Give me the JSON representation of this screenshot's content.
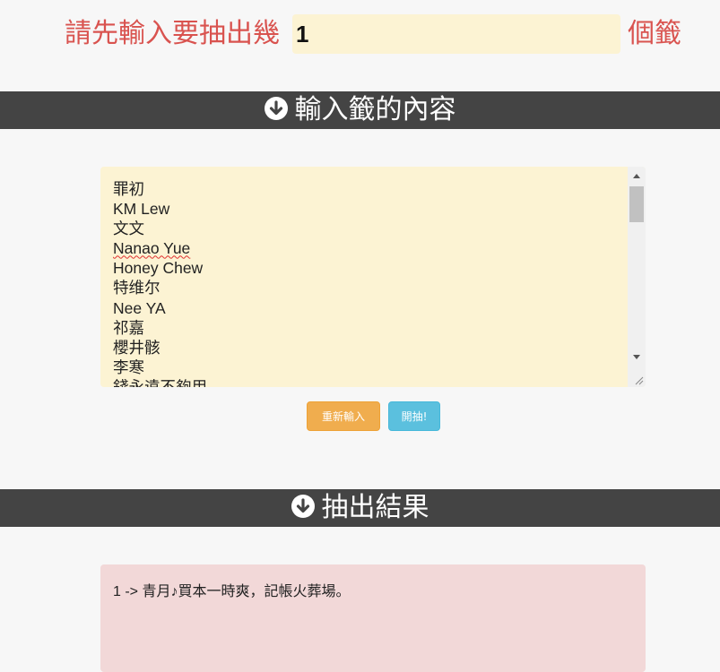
{
  "count_row": {
    "label_left": "請先輸入要抽出幾",
    "count_value": "1",
    "label_right": "個籤"
  },
  "input_section": {
    "title": "輸入籤的內容",
    "icon": "circle-arrow-down-icon",
    "lines": [
      "罪初",
      "KM Lew",
      "文文",
      "Nanao Yue",
      "Honey Chew",
      "特维尔",
      "Nee YA",
      "祁嘉",
      "櫻井骸",
      "李寒",
      "錢永遠不夠用"
    ]
  },
  "buttons": {
    "reset_label": "重新輸入",
    "start_label": "開抽!"
  },
  "result_section": {
    "title": "抽出結果",
    "icon": "circle-arrow-down-icon",
    "results": [
      "1 -> 青月♪買本一時爽，記帳火葬場。"
    ]
  },
  "colors": {
    "label_red": "#d9534f",
    "input_bg": "#fcf3d3",
    "header_bar": "#444444",
    "reset_button": "#f0ad4e",
    "start_button": "#5bc0de",
    "result_bg": "#f2d8d8"
  }
}
